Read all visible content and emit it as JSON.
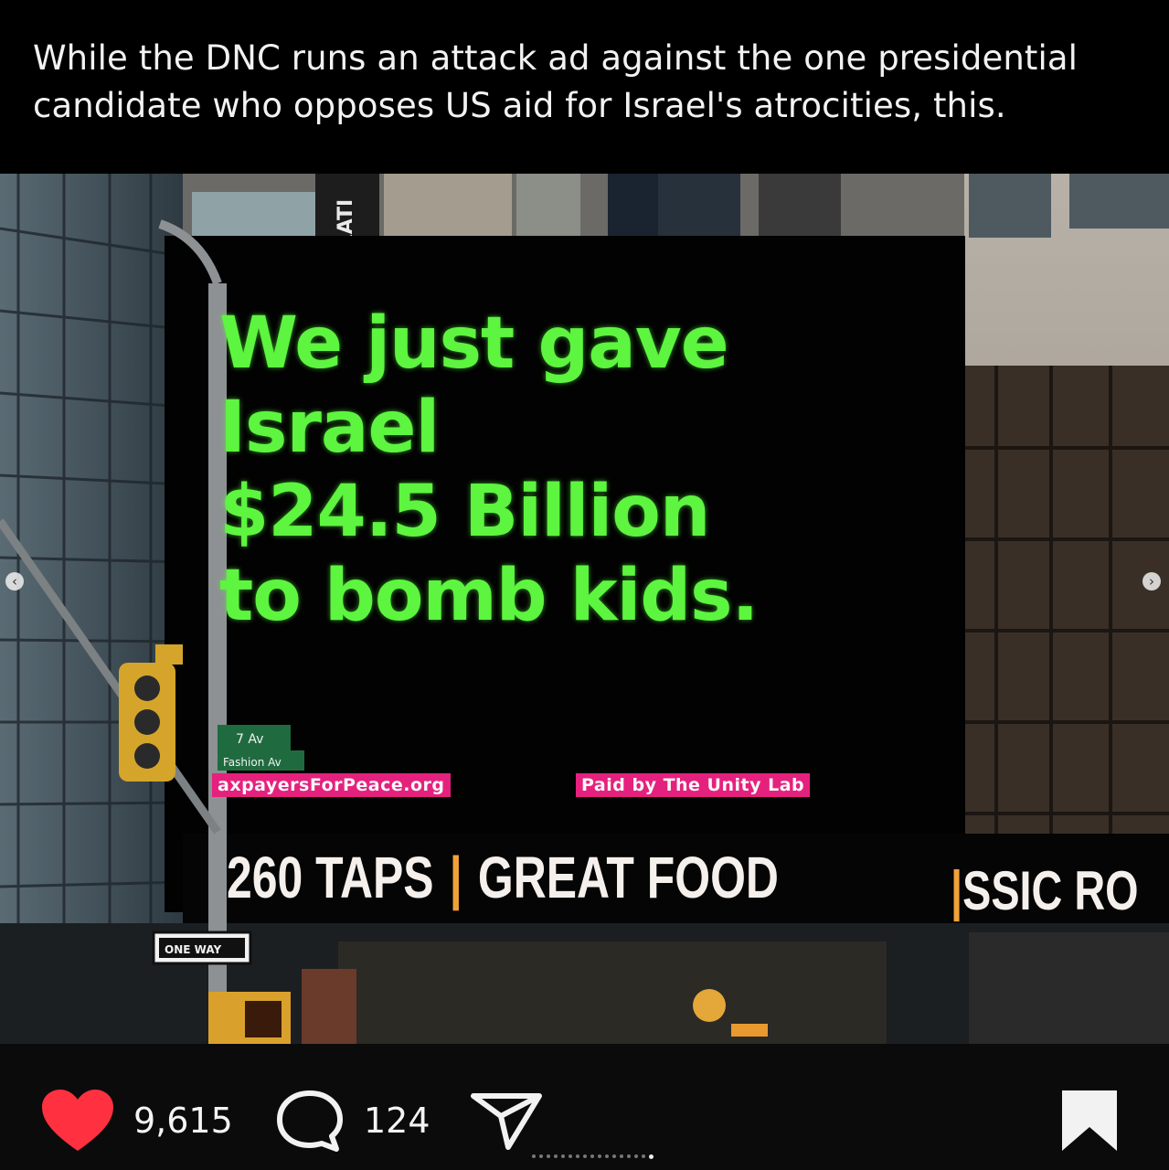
{
  "post": {
    "caption": "While the DNC runs an attack ad against the one presidential candidate who opposes US aid for Israel's atrocities, this."
  },
  "image": {
    "billboard_lines": [
      "We just gave",
      "Israel",
      "$24.5 Billion",
      "to bomb kids."
    ],
    "tag_left": "axpayersForPeace.org",
    "tag_right": "Paid by The Unity Lab",
    "ticker_left": "260 TAPS",
    "ticker_separator": "|",
    "ticker_right": "GREAT FOOD",
    "ticker_edge": "SSIC RO",
    "ticker_edge_bar": "|",
    "building_sign": "BRATI",
    "street_sign": "7 Av",
    "street_sign_sub": "Fashion Av",
    "one_way_sign": "ONE WAY",
    "colors": {
      "billboard_text": "#5df53f",
      "tag_background": "#e5217e",
      "ticker_separator": "#f0a23a"
    }
  },
  "carousel": {
    "prev_glyph": "‹",
    "next_glyph": "›",
    "total_slides": 17,
    "active_slide": 17
  },
  "actions": {
    "likes_count": "9,615",
    "comments_count": "124",
    "like_icon": "heart-icon",
    "comment_icon": "comment-bubble-icon",
    "share_icon": "paper-plane-icon",
    "save_icon": "bookmark-icon",
    "like_color": "#ff3040"
  }
}
